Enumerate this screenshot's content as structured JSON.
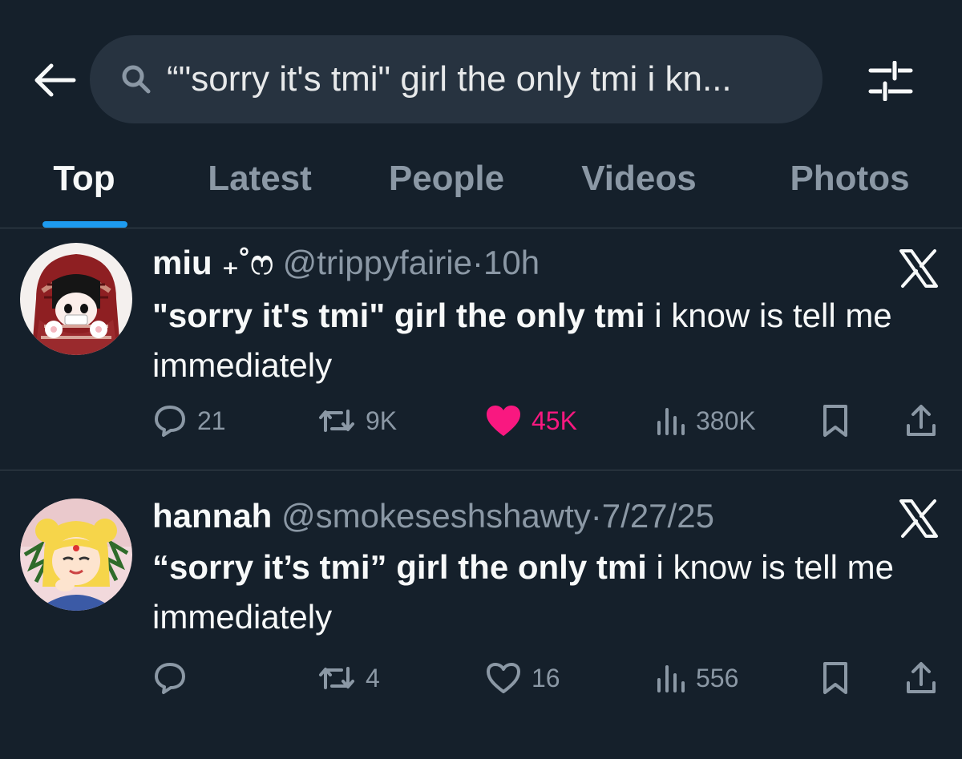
{
  "search": {
    "query": "“\"sorry it's tmi\" girl the only tmi i kn..."
  },
  "icons": {
    "back": "back-arrow-icon",
    "search": "search-icon",
    "filter": "filter-sliders-icon",
    "reply": "reply-icon",
    "retweet": "retweet-icon",
    "like": "heart-icon",
    "views": "views-icon",
    "bookmark": "bookmark-icon",
    "share": "share-icon",
    "more": "x-logo-icon"
  },
  "tabs": [
    {
      "label": "Top",
      "active": true
    },
    {
      "label": "Latest",
      "active": false
    },
    {
      "label": "People",
      "active": false
    },
    {
      "label": "Videos",
      "active": false
    },
    {
      "label": "Photos",
      "active": false
    }
  ],
  "colors": {
    "background": "#15202b",
    "accent": "#1d9bf0",
    "like": "#f91880",
    "muted": "#8b98a5",
    "search_bg": "#273340"
  },
  "tweets": [
    {
      "display_name": "miu ₊˚ෆ",
      "handle": "@trippyfairie",
      "separator": "·",
      "time": "10h",
      "text_bold_1": "\"sorry it's tmi\" girl the only tmi",
      "text_rest": " i know is tell me immediately",
      "replies": "21",
      "retweets": "9K",
      "likes": "45K",
      "liked": true,
      "views": "380K"
    },
    {
      "display_name": "hannah",
      "handle": "@smokeseshshawty",
      "separator": "·",
      "time": "7/27/25",
      "text_bold_1": "“sorry it’s tmi” girl the only tmi",
      "text_rest": " i know is tell me immediately",
      "replies": "",
      "retweets": "4",
      "likes": "16",
      "liked": false,
      "views": "556"
    }
  ]
}
